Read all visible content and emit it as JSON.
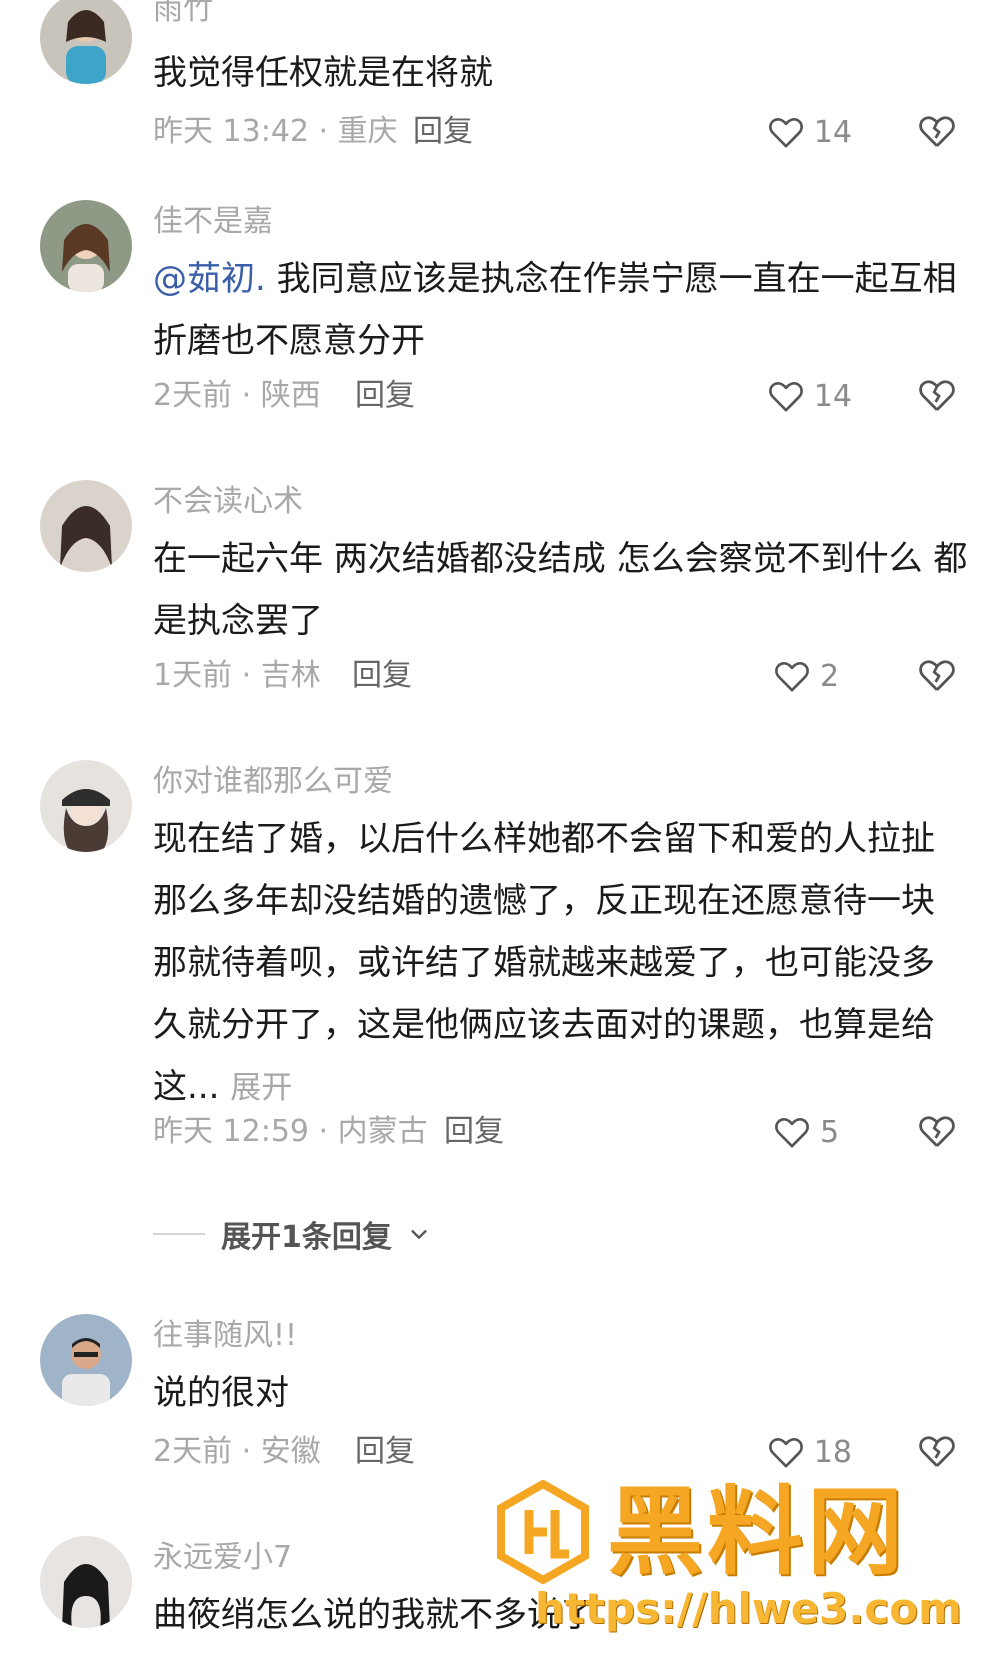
{
  "comments": [
    {
      "username": "雨竹",
      "content": "我觉得任权就是在将就",
      "meta": "昨天 13:42 · 重庆",
      "reply_label": "回复",
      "likes": "14"
    },
    {
      "username": "佳不是嘉",
      "mention": "@茹初.",
      "content": " 我同意应该是执念在作祟宁愿一直在一起互相折磨也不愿意分开",
      "meta": "2天前 · 陕西",
      "reply_label": "回复",
      "likes": "14"
    },
    {
      "username": "不会读心术",
      "content": "在一起六年 两次结婚都没结成 怎么会察觉不到什么 都是执念罢了",
      "meta": "1天前 · 吉林",
      "reply_label": "回复",
      "likes": "2"
    },
    {
      "username": "你对谁都那么可爱",
      "content": "现在结了婚，以后什么样她都不会留下和爱的人拉扯那么多年却没结婚的遗憾了，反正现在还愿意待一块那就待着呗，或许结了婚就越来越爱了，也可能没多久就分开了，这是他俩应该去面对的课题，也算是给这...",
      "expand_label": "展开",
      "meta": "昨天 12:59 · 内蒙古",
      "reply_label": "回复",
      "likes": "5",
      "expand_replies_label": "展开1条回复"
    },
    {
      "username": "往事随风!!",
      "content": "说的很对",
      "meta": "2天前 · 安徽",
      "reply_label": "回复",
      "likes": "18"
    },
    {
      "username": "永远爱小7",
      "content": "曲筱绡怎么说的我就不多说了",
      "meta": "",
      "reply_label": "",
      "likes": ""
    }
  ],
  "icons": {
    "like": "heart-outline-icon",
    "dislike": "broken-heart-icon",
    "expand": "chevron-down-icon"
  },
  "watermark": {
    "title": "黑料网",
    "url": "https://hlwe3.com"
  },
  "colors": {
    "username": "#a8a8a8",
    "mention": "#3a5ea8",
    "watermark": "#f5a623"
  }
}
